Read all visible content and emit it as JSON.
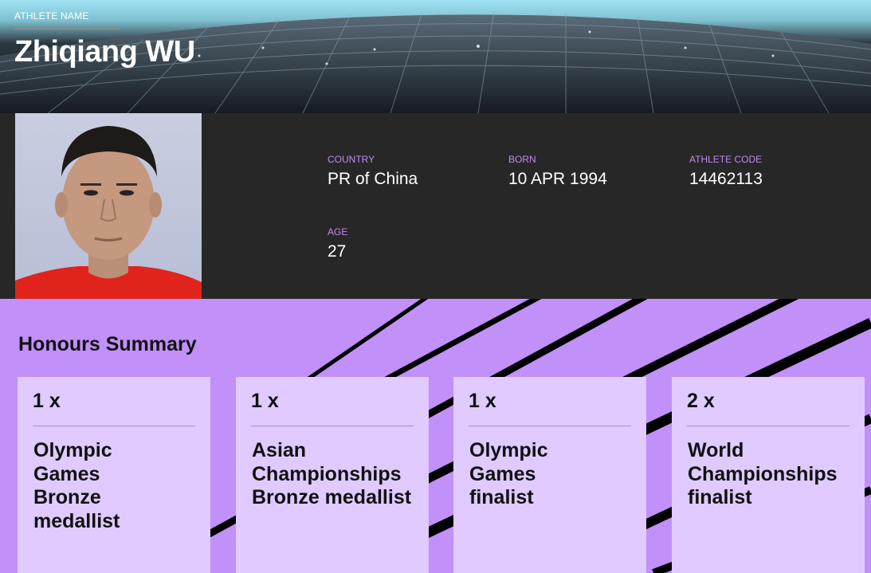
{
  "hero": {
    "label": "ATHLETE NAME",
    "name": "Zhiqiang WU"
  },
  "profile": {
    "fields": [
      {
        "label": "COUNTRY",
        "value": "PR of China"
      },
      {
        "label": "BORN",
        "value": "10 APR 1994"
      },
      {
        "label": "ATHLETE CODE",
        "value": "14462113"
      },
      {
        "label": "AGE",
        "value": "27"
      }
    ]
  },
  "honours": {
    "title": "Honours Summary",
    "cards": [
      {
        "count": "1 x",
        "title": "Olympic Games Bronze medallist"
      },
      {
        "count": "1 x",
        "title": "Asian Championships Bronze medallist"
      },
      {
        "count": "1 x",
        "title": "Olympic Games finalist"
      },
      {
        "count": "2 x",
        "title": "World Championships finalist"
      }
    ]
  },
  "colors": {
    "accent": "#c190f8",
    "card": "#e0caff",
    "label": "#c08af2",
    "band": "#272727"
  }
}
